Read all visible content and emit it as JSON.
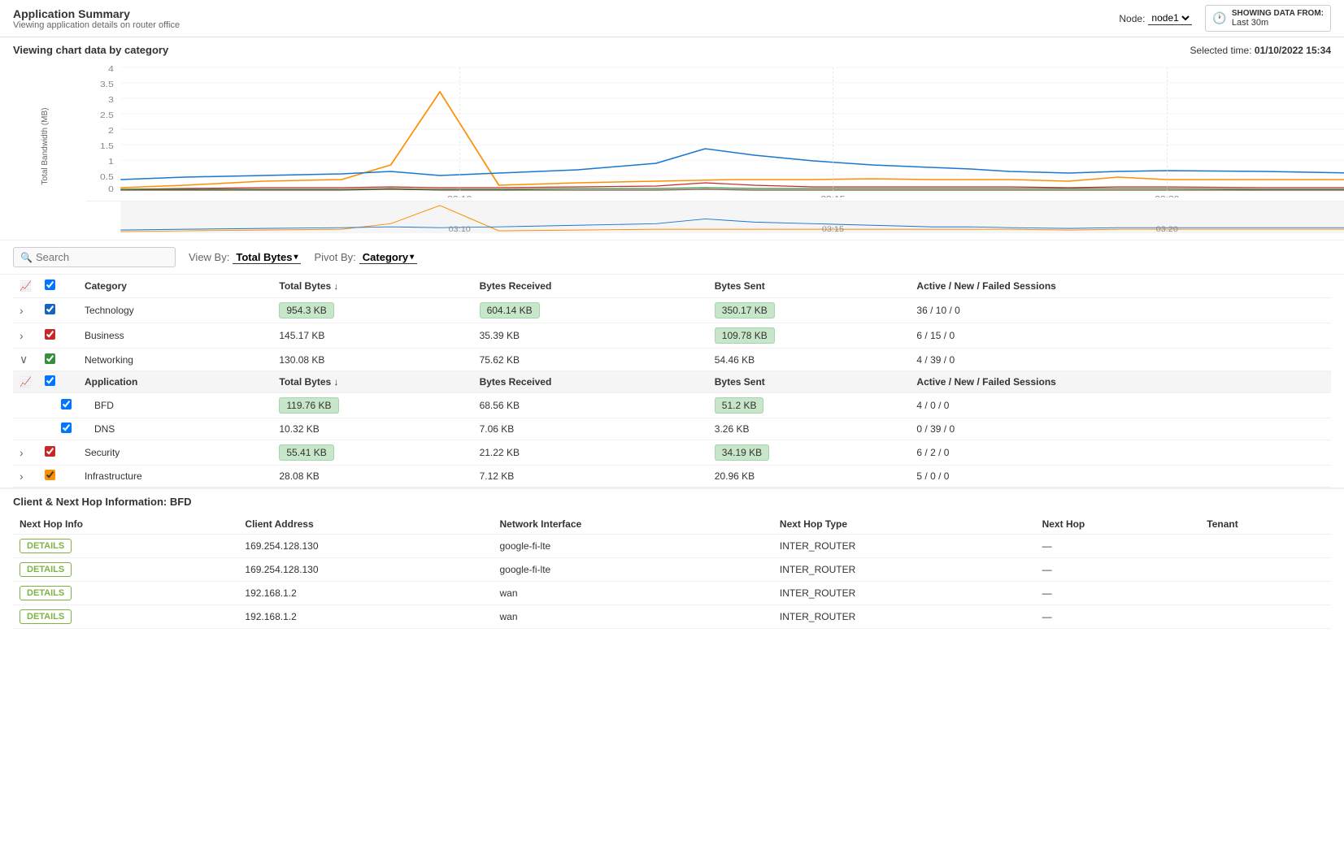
{
  "header": {
    "title": "Application Summary",
    "subtitle": "Viewing application details on router office",
    "node_label": "Node:",
    "node_value": "node1",
    "showing_label": "SHOWING DATA FROM:",
    "showing_value": "Last 30m"
  },
  "chart": {
    "title": "Viewing chart data by category",
    "selected_time_label": "Selected time:",
    "selected_time_value": "01/10/2022 15:34",
    "y_axis_label": "Total Bandwidth (MB)",
    "x_labels": [
      "03:10",
      "03:15",
      "03:20"
    ],
    "y_ticks": [
      "4",
      "3.5",
      "3",
      "2.5",
      "2",
      "1.5",
      "1",
      "0.5",
      "0"
    ]
  },
  "controls": {
    "search_placeholder": "Search",
    "view_by_label": "View By:",
    "view_by_value": "Total Bytes",
    "pivot_by_label": "Pivot By:",
    "pivot_by_value": "Category"
  },
  "table": {
    "columns": {
      "chart_icon": "",
      "check": "",
      "category": "Category",
      "total_bytes": "Total Bytes",
      "bytes_received": "Bytes Received",
      "bytes_sent": "Bytes Sent",
      "sessions": "Active / New / Failed Sessions"
    },
    "rows": [
      {
        "type": "category",
        "expanded": false,
        "checked": true,
        "check_color": "blue",
        "name": "Technology",
        "total_bytes": "954.3 KB",
        "total_bytes_highlight": true,
        "bytes_received": "604.14 KB",
        "bytes_received_highlight": true,
        "bytes_sent": "350.17 KB",
        "bytes_sent_highlight": true,
        "sessions": "36 / 10 / 0"
      },
      {
        "type": "category",
        "expanded": false,
        "checked": true,
        "check_color": "red",
        "name": "Business",
        "total_bytes": "145.17 KB",
        "total_bytes_highlight": false,
        "bytes_received": "35.39 KB",
        "bytes_received_highlight": false,
        "bytes_sent": "109.78 KB",
        "bytes_sent_highlight": true,
        "sessions": "6 / 15 / 0"
      },
      {
        "type": "category",
        "expanded": true,
        "checked": true,
        "check_color": "green",
        "name": "Networking",
        "total_bytes": "130.08 KB",
        "total_bytes_highlight": false,
        "bytes_received": "75.62 KB",
        "bytes_received_highlight": false,
        "bytes_sent": "54.46 KB",
        "bytes_sent_highlight": false,
        "sessions": "4 / 39 / 0"
      },
      {
        "type": "sub_header",
        "col_category": "Application",
        "col_total_bytes": "Total Bytes",
        "col_bytes_received": "Bytes Received",
        "col_bytes_sent": "Bytes Sent",
        "col_sessions": "Active / New / Failed Sessions"
      },
      {
        "type": "application",
        "checked": true,
        "name": "BFD",
        "total_bytes": "119.76 KB",
        "total_bytes_highlight": true,
        "bytes_received": "68.56 KB",
        "bytes_received_highlight": false,
        "bytes_sent": "51.2 KB",
        "bytes_sent_highlight": true,
        "sessions": "4 / 0 / 0"
      },
      {
        "type": "application",
        "checked": true,
        "name": "DNS",
        "total_bytes": "10.32 KB",
        "total_bytes_highlight": false,
        "bytes_received": "7.06 KB",
        "bytes_received_highlight": false,
        "bytes_sent": "3.26 KB",
        "bytes_sent_highlight": false,
        "sessions": "0 / 39 / 0"
      },
      {
        "type": "category",
        "expanded": false,
        "checked": true,
        "check_color": "red",
        "name": "Security",
        "total_bytes": "55.41 KB",
        "total_bytes_highlight": true,
        "bytes_received": "21.22 KB",
        "bytes_received_highlight": false,
        "bytes_sent": "34.19 KB",
        "bytes_sent_highlight": true,
        "sessions": "6 / 2 / 0"
      },
      {
        "type": "category",
        "expanded": false,
        "checked": true,
        "check_color": "orange",
        "name": "Infrastructure",
        "total_bytes": "28.08 KB",
        "total_bytes_highlight": false,
        "bytes_received": "7.12 KB",
        "bytes_received_highlight": false,
        "bytes_sent": "20.96 KB",
        "bytes_sent_highlight": false,
        "sessions": "5 / 0 / 0"
      }
    ]
  },
  "bottom": {
    "title": "Client & Next Hop Information: BFD",
    "columns": [
      "Next Hop Info",
      "Client Address",
      "Network Interface",
      "Next Hop Type",
      "Next Hop",
      "Tenant"
    ],
    "rows": [
      {
        "btn": "DETAILS",
        "client_address": "169.254.128.130",
        "network_interface": "google-fi-lte",
        "next_hop_type": "INTER_ROUTER",
        "next_hop": "—",
        "tenant": ""
      },
      {
        "btn": "DETAILS",
        "client_address": "169.254.128.130",
        "network_interface": "google-fi-lte",
        "next_hop_type": "INTER_ROUTER",
        "next_hop": "—",
        "tenant": ""
      },
      {
        "btn": "DETAILS",
        "client_address": "192.168.1.2",
        "network_interface": "wan",
        "next_hop_type": "INTER_ROUTER",
        "next_hop": "—",
        "tenant": ""
      },
      {
        "btn": "DETAILS",
        "client_address": "192.168.1.2",
        "network_interface": "wan",
        "next_hop_type": "INTER_ROUTER",
        "next_hop": "—",
        "tenant": ""
      }
    ]
  },
  "colors": {
    "accent_green": "#7cb342",
    "blue": "#1565c0",
    "orange": "#e65100",
    "red": "#c62828",
    "line_blue": "#1976d2",
    "line_orange": "#ff8f00",
    "line_red": "#c62828",
    "line_green": "#388e3c",
    "line_brown": "#795548"
  }
}
